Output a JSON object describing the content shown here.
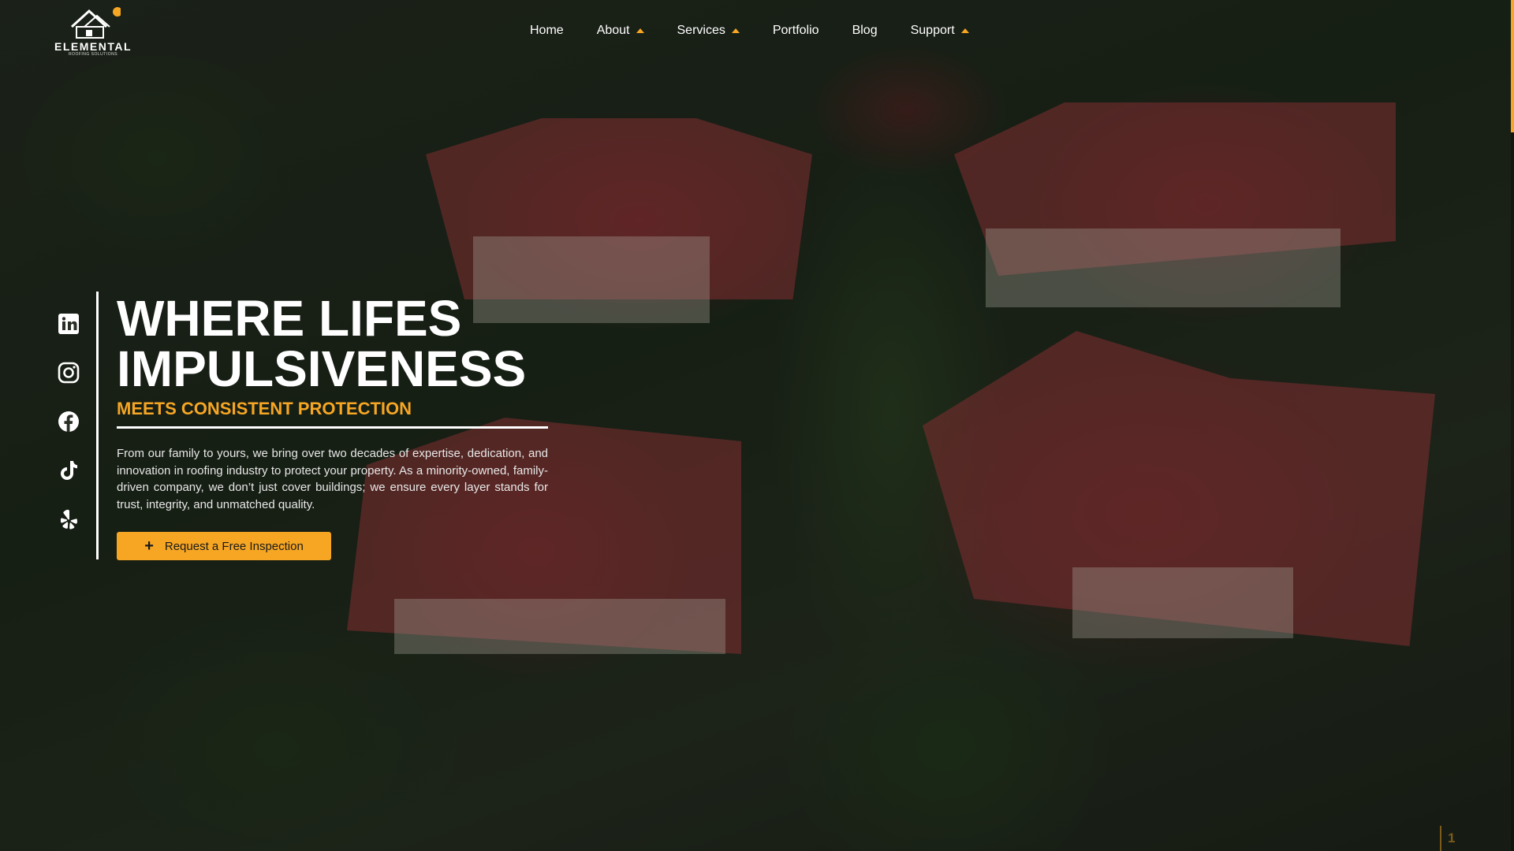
{
  "logo": {
    "name": "ELEMENTAL",
    "tagline": "ROOFING SOLUTIONS"
  },
  "nav": {
    "items": [
      {
        "label": "Home",
        "dropdown": false
      },
      {
        "label": "About",
        "dropdown": true
      },
      {
        "label": "Services",
        "dropdown": true
      },
      {
        "label": "Portfolio",
        "dropdown": false
      },
      {
        "label": "Blog",
        "dropdown": false
      },
      {
        "label": "Support",
        "dropdown": true
      }
    ]
  },
  "socials": [
    "linkedin-icon",
    "instagram-icon",
    "facebook-icon",
    "tiktok-icon",
    "yelp-icon"
  ],
  "hero": {
    "headline_line1": "WHERE LIFES",
    "headline_line2": "IMPULSIVENESS",
    "subheadline": "MEETS CONSISTENT PROTECTION",
    "paragraph": "From our family to yours, we bring over two decades of expertise, dedication, and innovation in roofing industry to protect your property. As a minority-owned, family-driven company, we don’t just cover buildings; we ensure every layer stands for trust, integrity, and unmatched quality.",
    "cta_label": "Request a Free Inspection"
  },
  "slider": {
    "current": "1"
  },
  "colors": {
    "accent": "#f6a623",
    "text": "#ffffff"
  }
}
